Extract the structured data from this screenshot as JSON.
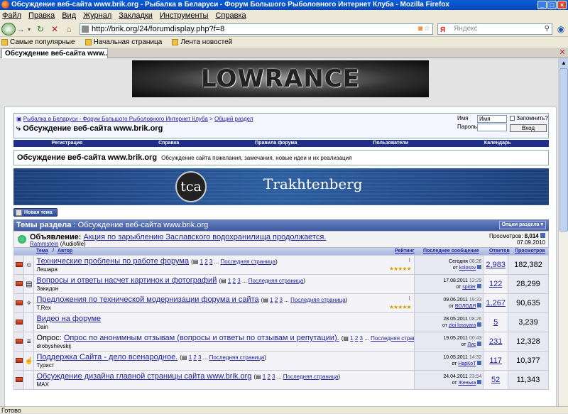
{
  "browser": {
    "window_title": "Обсуждение веб-сайта www.brik.org - Рыбалка в Беларуси - Форум Большого Рыболовного Интернет Клуба - Mozilla Firefox",
    "menu": [
      "Файл",
      "Правка",
      "Вид",
      "Журнал",
      "Закладки",
      "Инструменты",
      "Справка"
    ],
    "url": "http://brik.org/24/forumdisplay.php?f=8",
    "search_placeholder": "Яндекс",
    "bookmarks": [
      "Самые популярные",
      "Начальная страница",
      "Лента новостей"
    ],
    "tab_title": "Обсуждение веб-сайта www....",
    "status": "Готово"
  },
  "site": {
    "top_banner": "LOWRANCE",
    "breadcrumb_home": "Рыбалка в Беларуси - Форум Большого Рыболовного Интернет Клуба",
    "breadcrumb_sep": ">",
    "breadcrumb_section": "Общий раздел",
    "page_title": "Обсуждение веб-сайта www.brik.org",
    "login": {
      "name_label": "Имя",
      "name_value": "Имя",
      "password_label": "Пароль",
      "remember_label": "Запомнить?",
      "submit_label": "Вход"
    },
    "nav": [
      "Регистрация",
      "Справка",
      "Правила форума",
      "Пользователи",
      "Календарь"
    ],
    "forum_title": "Обсуждение веб-сайта www.brik.org",
    "forum_desc": "Обсуждение сайта пожелания, замечания, новые идеи и их реализация",
    "sponsor_logo": "tca",
    "sponsor_name": "Trakhtenberg",
    "new_topic_label": "Новая тема",
    "threads_header_label": "Темы раздела",
    "threads_header_sep": ":",
    "threads_header_name": "Обсуждение веб-сайта www.brik.org",
    "forum_options_label": "Опции раздела ▾"
  },
  "announcement": {
    "label": "Объявление:",
    "title": "Акция по зарыблению Заславского водохранилища продолжается.",
    "author": "Rammstein",
    "author_title": "(Audiofile)",
    "views_label": "Просмотров:",
    "views_value": "8,014",
    "date": "07.09.2010"
  },
  "columns": {
    "topic": "Тема",
    "sep": "/",
    "author": "Автор",
    "rating": "Рейтинг",
    "last_post": "Последнее сообщение",
    "replies": "Ответов",
    "views": "Просмотров"
  },
  "topics": [
    {
      "icon": "smile-icon",
      "ti": "☺",
      "prefix": "",
      "title": "Технические проблены по работе форума",
      "pages": [
        "1",
        "2",
        "3"
      ],
      "last_link": "Последняя страница",
      "author": "Лешара",
      "rating": "★★★★★",
      "attach": true,
      "last_date": "Сегодня",
      "last_time": "08:26",
      "last_by_label": "от",
      "last_user": "kolosov",
      "replies": "2,983",
      "views": "182,382"
    },
    {
      "icon": "doc-icon",
      "ti": "▤",
      "prefix": "",
      "title": "Вопросы и ответы насчет картинок и фотографий",
      "pages": [
        "1",
        "2",
        "3"
      ],
      "last_link": "Последняя страница",
      "author": "Закидон",
      "rating": "",
      "attach": false,
      "last_date": "17.08.2011",
      "last_time": "12:29",
      "last_by_label": "от",
      "last_user": "spider",
      "replies": "122",
      "views": "28,299"
    },
    {
      "icon": "lightbulb-icon",
      "ti": "✧",
      "prefix": "",
      "title": "Предложения по технической модернизации форума и сайта",
      "pages": [
        "1",
        "2",
        "3"
      ],
      "last_link": "Последняя страница",
      "author": "T.Rex",
      "rating": "★★★★★",
      "attach": true,
      "last_date": "09.06.2011",
      "last_time": "19:33",
      "last_by_label": "от",
      "last_user": "ВОЛОДЯ",
      "replies": "1,267",
      "views": "90,635"
    },
    {
      "icon": "",
      "ti": "",
      "prefix": "",
      "title": "Видео на форуме",
      "pages": [],
      "last_link": "",
      "author": "Dain",
      "rating": "",
      "attach": false,
      "last_date": "28.05.2011",
      "last_time": "08:26",
      "last_by_label": "от",
      "last_user": "zloi lossyara",
      "replies": "5",
      "views": "3,239"
    },
    {
      "icon": "poll-icon",
      "ti": "≡",
      "prefix": "Опрос:",
      "title": "Опрос по анонимным отзывам (вопросы и ответы по отзывам и репутации).",
      "pages": [
        "1",
        "2",
        "3"
      ],
      "last_link": "Последняя страница",
      "author": "drobyshevskij",
      "rating": "",
      "attach": false,
      "last_date": "19.05.2011",
      "last_time": "00:43",
      "last_by_label": "от",
      "last_user": "Лис",
      "replies": "231",
      "views": "12,328"
    },
    {
      "icon": "thumbs-up-icon",
      "ti": "☝",
      "prefix": "",
      "title": "Поддержка Сайта - дело всенародное.",
      "pages": [
        "1",
        "2",
        "3"
      ],
      "last_link": "Последняя страница",
      "author": "Турист",
      "rating": "",
      "attach": false,
      "last_date": "10.05.2011",
      "last_time": "14:32",
      "last_by_label": "от",
      "last_user": "НарКоТ",
      "replies": "117",
      "views": "10,377"
    },
    {
      "icon": "",
      "ti": "",
      "prefix": "",
      "title": "Обсуждение дизайна главной страницы сайта www.brik.org",
      "pages": [
        "1",
        "2",
        "3"
      ],
      "last_link": "Последняя страница",
      "author": "MAX",
      "rating": "",
      "attach": false,
      "last_date": "24.04.2011",
      "last_time": "23:54",
      "last_by_label": "от",
      "last_user": "Женька",
      "replies": "52",
      "views": "11,343"
    }
  ]
}
